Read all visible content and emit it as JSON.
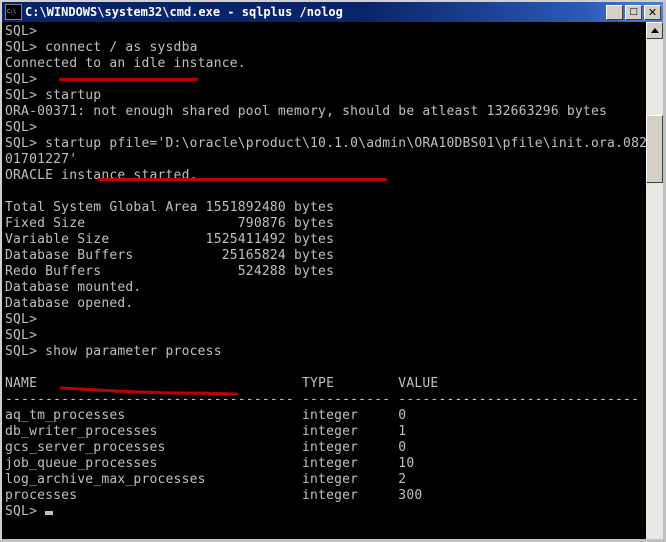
{
  "window": {
    "title": "C:\\WINDOWS\\system32\\cmd.exe - sqlplus /nolog",
    "icon": "cmd-console-icon",
    "buttons": {
      "minimize": "_",
      "maximize": "□",
      "close": "✕"
    },
    "colors": {
      "titlebar_start": "#0a246a",
      "titlebar_end": "#4f82d6",
      "console_bg": "#000000",
      "console_fg": "#c0c0c0",
      "chrome": "#d4d0c8",
      "annotation": "#c00000"
    }
  },
  "scrollbar": {
    "up_arrow": "▲",
    "thumb_label": "scroll-thumb"
  },
  "console": {
    "prompt": "SQL>",
    "cursor": "block-cursor",
    "lines": [
      "SQL>",
      "SQL> connect / as sysdba",
      "Connected to an idle instance.",
      "SQL>",
      "SQL> startup",
      "ORA-00371: not enough shared pool memory, should be atleast 132663296 bytes",
      "SQL>",
      "SQL> startup pfile='D:\\oracle\\product\\10.1.0\\admin\\ORA10DBS01\\pfile\\init.ora.082",
      "01701227'",
      "ORACLE instance started.",
      "",
      "Total System Global Area 1551892480 bytes",
      "Fixed Size                   790876 bytes",
      "Variable Size            1525411492 bytes",
      "Database Buffers           25165824 bytes",
      "Redo Buffers                 524288 bytes",
      "Database mounted.",
      "Database opened.",
      "SQL>",
      "SQL>",
      "SQL> show parameter process",
      "",
      "NAME                                 TYPE        VALUE",
      "------------------------------------ ----------- ------------------------------",
      "aq_tm_processes                      integer     0",
      "db_writer_processes                  integer     1",
      "gcs_server_processes                 integer     0",
      "job_queue_processes                  integer     10",
      "log_archive_max_processes            integer     2",
      "processes                            integer     300",
      "SQL>"
    ],
    "commands": [
      "connect / as sysdba",
      "startup",
      "startup pfile='D:\\oracle\\product\\10.1.0\\admin\\ORA10DBS01\\pfile\\init.ora.08201701227'",
      "show parameter process"
    ],
    "sga": {
      "header": "Total System Global Area",
      "total_bytes": "1551892480",
      "rows": [
        {
          "label": "Fixed Size",
          "value": "790876",
          "unit": "bytes"
        },
        {
          "label": "Variable Size",
          "value": "1525411492",
          "unit": "bytes"
        },
        {
          "label": "Database Buffers",
          "value": "25165824",
          "unit": "bytes"
        },
        {
          "label": "Redo Buffers",
          "value": "524288",
          "unit": "bytes"
        }
      ]
    },
    "parameter_table": {
      "columns": [
        "NAME",
        "TYPE",
        "VALUE"
      ],
      "rows": [
        {
          "name": "aq_tm_processes",
          "type": "integer",
          "value": "0"
        },
        {
          "name": "db_writer_processes",
          "type": "integer",
          "value": "1"
        },
        {
          "name": "gcs_server_processes",
          "type": "integer",
          "value": "0"
        },
        {
          "name": "job_queue_processes",
          "type": "integer",
          "value": "10"
        },
        {
          "name": "log_archive_max_processes",
          "type": "integer",
          "value": "2"
        },
        {
          "name": "processes",
          "type": "integer",
          "value": "300"
        }
      ]
    },
    "messages": [
      "Connected to an idle instance.",
      "ORA-00371: not enough shared pool memory, should be atleast 132663296 bytes",
      "ORACLE instance started.",
      "Database mounted.",
      "Database opened."
    ]
  },
  "annotations": [
    {
      "name": "underline-connect-command",
      "target": "connect / as sysdba"
    },
    {
      "name": "underline-pfile-path",
      "target": "startup pfile=..."
    },
    {
      "name": "underline-show-parameter",
      "target": "show parameter process"
    }
  ]
}
